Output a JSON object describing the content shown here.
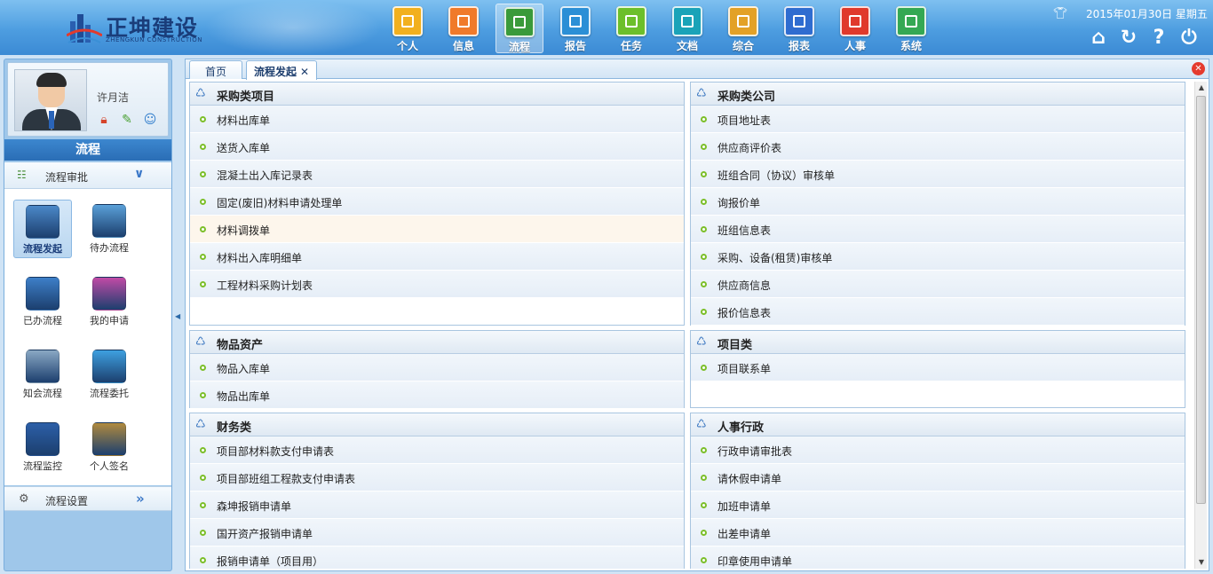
{
  "header": {
    "logo_title": "正坤建设",
    "logo_subtitle": "ZHENGKUN CONSTRUCTION",
    "nav": [
      {
        "label": "个人",
        "icon": "person-icon",
        "color": "#f2b01e"
      },
      {
        "label": "信息",
        "icon": "message-icon",
        "color": "#f07a2a"
      },
      {
        "label": "流程",
        "icon": "flowchart-icon",
        "color": "#3a9a3a",
        "active": true
      },
      {
        "label": "报告",
        "icon": "report-icon",
        "color": "#2b8fd6"
      },
      {
        "label": "任务",
        "icon": "task-icon",
        "color": "#6cbf2a"
      },
      {
        "label": "文档",
        "icon": "folder-icon",
        "color": "#1aa3b8"
      },
      {
        "label": "综合",
        "icon": "integrated-icon",
        "color": "#e3a126"
      },
      {
        "label": "报表",
        "icon": "bar-chart-icon",
        "color": "#2f6cd0"
      },
      {
        "label": "人事",
        "icon": "personnel-icon",
        "color": "#e0392b"
      },
      {
        "label": "系统",
        "icon": "gear-icon",
        "color": "#34a853"
      }
    ],
    "date": "2015年01月30日 星期五",
    "shirt_icon": "shirt-icon",
    "actions": [
      "home-icon",
      "refresh-icon",
      "help-icon",
      "power-icon"
    ]
  },
  "sidebar": {
    "username": "许月洁",
    "profile_icons": [
      "lock-icon",
      "edit-icon",
      "user-icon"
    ],
    "section_title": "流程",
    "menu_head": "流程审批",
    "tiles": [
      {
        "label": "流程发起",
        "icon": "process-start-icon",
        "color": "#4b88c8",
        "active": true
      },
      {
        "label": "待办流程",
        "icon": "clock-icon",
        "color": "#5aa0d8"
      },
      {
        "label": "已办流程",
        "icon": "check-circle-icon",
        "color": "#3d7fc8"
      },
      {
        "label": "我的申请",
        "icon": "user-request-icon",
        "color": "#c14aa6"
      },
      {
        "label": "知会流程",
        "icon": "magnifier-icon",
        "color": "#8aa8c4"
      },
      {
        "label": "流程委托",
        "icon": "hierarchy-icon",
        "color": "#3ea0e0"
      },
      {
        "label": "流程监控",
        "icon": "compass-icon",
        "color": "#2c5fa8"
      },
      {
        "label": "个人签名",
        "icon": "signature-icon",
        "color": "#b08a3e"
      }
    ],
    "settings_label": "流程设置"
  },
  "tabs": [
    {
      "label": "首页"
    },
    {
      "label": "流程发起",
      "active": true
    }
  ],
  "panels": [
    {
      "title": "采购类项目",
      "items": [
        "材料出库单",
        "送货入库单",
        "混凝土出入库记录表",
        "固定(废旧)材料申请处理单",
        "材料调拨单",
        "材料出入库明细单",
        "工程材料采购计划表"
      ],
      "highlight": 4
    },
    {
      "title": "采购类公司",
      "items": [
        "项目地址表",
        "供应商评价表",
        "班组合同（协议）审核单",
        "询报价单",
        "班组信息表",
        "采购、设备(租赁)审核单",
        "供应商信息",
        "报价信息表"
      ]
    },
    {
      "title": "物品资产",
      "items": [
        "物品入库单",
        "物品出库单"
      ]
    },
    {
      "title": "项目类",
      "items": [
        "项目联系单"
      ]
    },
    {
      "title": "财务类",
      "items": [
        "项目部材料款支付申请表",
        "项目部班组工程款支付申请表",
        "森坤报销申请单",
        "国开资产报销申请单",
        "报销申请单（项目用）"
      ]
    },
    {
      "title": "人事行政",
      "items": [
        "行政申请审批表",
        "请休假申请单",
        "加班申请单",
        "出差申请单",
        "印章使用申请单"
      ]
    }
  ]
}
